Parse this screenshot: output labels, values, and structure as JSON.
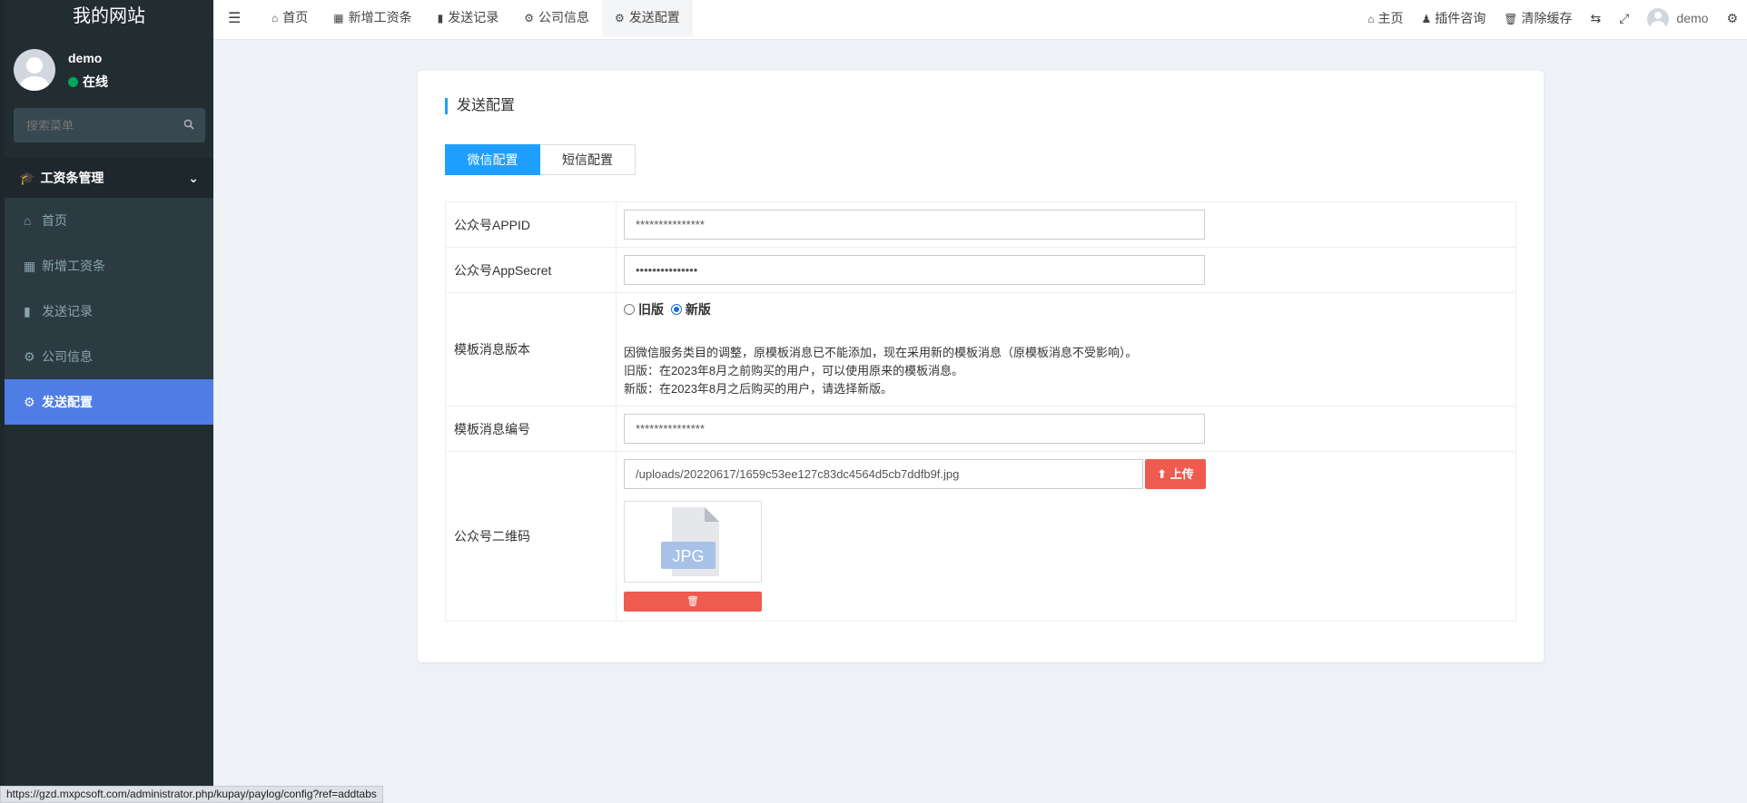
{
  "sidebar": {
    "logo": "我的网站",
    "user_name": "demo",
    "user_status": "在线",
    "search_placeholder": "搜索菜单",
    "group_label": "工资条管理",
    "items": [
      {
        "label": "首页",
        "icon": "home-icon"
      },
      {
        "label": "新增工资条",
        "icon": "calendar-icon"
      },
      {
        "label": "发送记录",
        "icon": "file-icon"
      },
      {
        "label": "公司信息",
        "icon": "cogs-icon"
      },
      {
        "label": "发送配置",
        "icon": "cogs-icon",
        "active": true
      }
    ]
  },
  "topbar": {
    "tabs": [
      {
        "label": "首页"
      },
      {
        "label": "新增工资条"
      },
      {
        "label": "发送记录"
      },
      {
        "label": "公司信息"
      },
      {
        "label": "发送配置",
        "active": true
      }
    ],
    "right": {
      "home": "主页",
      "plugin": "插件咨询",
      "clear_cache": "清除缓存",
      "user": "demo"
    }
  },
  "main": {
    "title": "发送配置",
    "subtabs": [
      "微信配置",
      "短信配置"
    ],
    "form": {
      "appid_label": "公众号APPID",
      "appid_value": "***************",
      "secret_label": "公众号AppSecret",
      "secret_value": "•••••••••••••••",
      "version_label": "模板消息版本",
      "version_old": "旧版",
      "version_new": "新版",
      "note1": "因微信服务类目的调整，原模板消息已不能添加，现在采用新的模板消息（原模板消息不受影响）。",
      "note2": "旧版：在2023年8月之前购买的用户，可以使用原来的模板消息。",
      "note3": "新版：在2023年8月之后购买的用户，请选择新版。",
      "template_label": "模板消息编号",
      "template_value": "***************",
      "qrcode_label": "公众号二维码",
      "qrcode_value": "/uploads/20220617/1659c53ee127c83dc4564d5cb7ddfb9f.jpg",
      "upload_label": "上传",
      "thumb_text": "JPG"
    }
  },
  "statusbar": "https://gzd.mxpcsoft.com/administrator.php/kupay/paylog/config?ref=addtabs",
  "colors": {
    "accent": "#1e9fff",
    "active_nav": "#4f7de6",
    "danger": "#f05b4f",
    "sidebar": "#222d32"
  }
}
